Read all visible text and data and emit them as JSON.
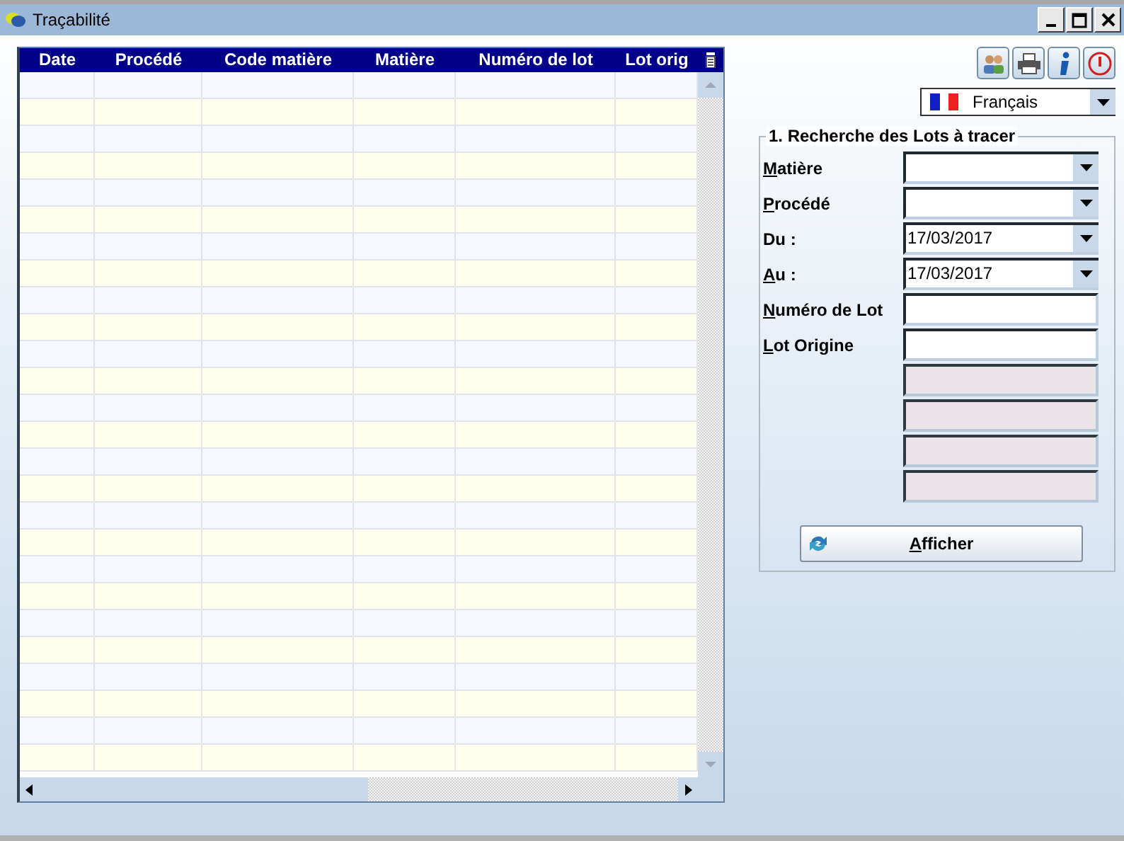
{
  "window": {
    "title": "Traçabilité"
  },
  "table": {
    "columns": [
      "Date",
      "Procédé",
      "Code matière",
      "Matière",
      "Numéro de lot",
      "Lot orig"
    ]
  },
  "language": {
    "value": "Français"
  },
  "search_group": {
    "title": "1. Recherche des Lots à tracer",
    "fields": [
      {
        "label": "Matière",
        "mnemonic": true,
        "kind": "combo",
        "disabled": false
      },
      {
        "label": "Procédé",
        "mnemonic": true,
        "kind": "combo",
        "disabled": false
      },
      {
        "label": "Du :",
        "mnemonic": false,
        "kind": "combo",
        "value": "17/03/2017",
        "disabled": false
      },
      {
        "label": "Au :",
        "mnemonic": true,
        "kind": "combo",
        "value": "17/03/2017",
        "disabled": false
      },
      {
        "label": "Numéro de Lot",
        "mnemonic": true,
        "kind": "text",
        "disabled": false
      },
      {
        "label": "Lot Origine",
        "mnemonic": true,
        "kind": "text",
        "disabled": false
      },
      {
        "kind": "text",
        "disabled": true
      },
      {
        "kind": "text",
        "disabled": true
      },
      {
        "kind": "text",
        "disabled": true
      },
      {
        "kind": "text",
        "disabled": true
      }
    ],
    "button": {
      "label": "Afficher",
      "mnemonic": true
    }
  }
}
